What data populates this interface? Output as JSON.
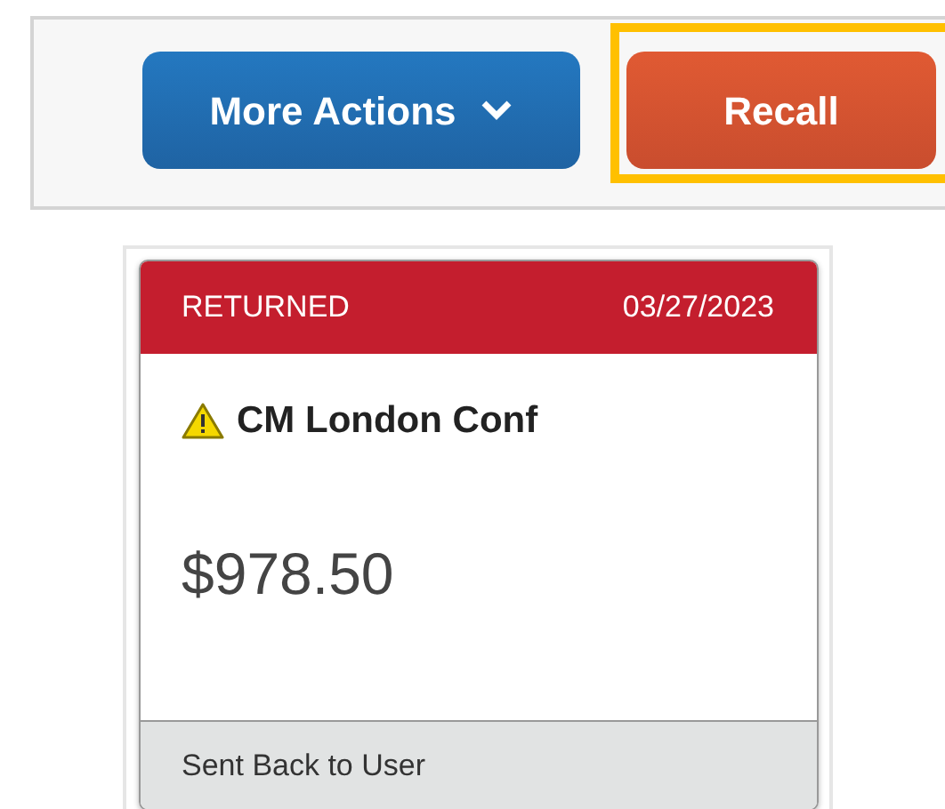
{
  "toolbar": {
    "buttons": [
      {
        "label": "More Actions",
        "kind": "dropdown",
        "highlighted": false
      },
      {
        "label": "Recall",
        "kind": "action",
        "highlighted": true
      }
    ]
  },
  "report_card": {
    "status": "RETURNED",
    "date": "03/27/2023",
    "warning": true,
    "title": "CM London Conf",
    "amount": "$978.50",
    "footer": "Sent Back to User"
  }
}
